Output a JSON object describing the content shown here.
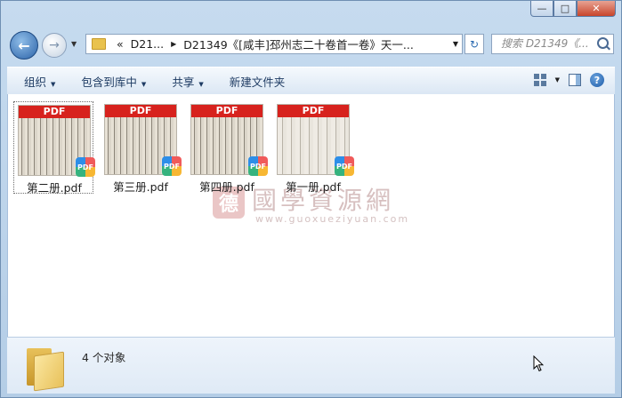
{
  "window": {
    "min_symbol": "—",
    "max_symbol": "□",
    "close_symbol": "✕"
  },
  "nav": {
    "back_icon": "back-arrow-icon",
    "forward_icon": "forward-arrow-icon",
    "address": {
      "overflow": "«",
      "segments": [
        "D21...",
        "D21349《[咸丰]邳州志二十卷首一卷》天一..."
      ]
    },
    "search_placeholder": "搜索 D21349《..."
  },
  "toolbar": {
    "organize": "组织",
    "include_library": "包含到库中",
    "share": "共享",
    "new_folder": "新建文件夹"
  },
  "files": [
    {
      "name": "第二册.pdf",
      "selected": true
    },
    {
      "name": "第三册.pdf",
      "selected": false
    },
    {
      "name": "第四册.pdf",
      "selected": false
    },
    {
      "name": "第一册.pdf",
      "selected": false
    }
  ],
  "thumb_label": "PDF",
  "badge_label": "PDF",
  "watermark": {
    "seal": "德",
    "title": "國學資源網",
    "url": "www.guoxueziyuan.com"
  },
  "details": {
    "count": "4 个对象"
  }
}
